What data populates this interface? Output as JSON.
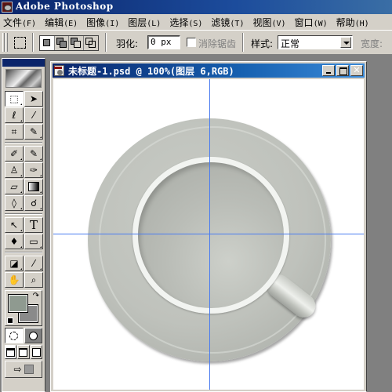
{
  "app": {
    "title": "Adobe Photoshop"
  },
  "menubar": {
    "items": [
      {
        "label": "文件",
        "accel": "(F)"
      },
      {
        "label": "编辑",
        "accel": "(E)"
      },
      {
        "label": "图像",
        "accel": "(I)"
      },
      {
        "label": "图层",
        "accel": "(L)"
      },
      {
        "label": "选择",
        "accel": "(S)"
      },
      {
        "label": "滤镜",
        "accel": "(T)"
      },
      {
        "label": "视图",
        "accel": "(V)"
      },
      {
        "label": "窗口",
        "accel": "(W)"
      },
      {
        "label": "帮助",
        "accel": "(H)"
      }
    ]
  },
  "options": {
    "feather_label": "羽化:",
    "feather_value": "0 px",
    "antialias_label": "消除锯齿",
    "antialias_checked": false,
    "style_label": "样式:",
    "style_value": "正常",
    "width_label": "宽度:",
    "selection_modes": [
      "new-selection",
      "add-to-selection",
      "subtract-from-selection",
      "intersect-selection"
    ],
    "active_mode": "new-selection"
  },
  "toolbox": {
    "tools": [
      {
        "name": "rectangular-marquee",
        "glyph": "⬚",
        "active": true
      },
      {
        "name": "move",
        "glyph": "➤"
      },
      {
        "name": "lasso",
        "glyph": "ℓ"
      },
      {
        "name": "magic-wand",
        "glyph": "⁄"
      },
      {
        "name": "crop",
        "glyph": "⌗"
      },
      {
        "name": "slice",
        "glyph": "✎"
      },
      {
        "name": "healing-brush",
        "glyph": "✐"
      },
      {
        "name": "brush",
        "glyph": "✎"
      },
      {
        "name": "clone-stamp",
        "glyph": "♙"
      },
      {
        "name": "history-brush",
        "glyph": "✑"
      },
      {
        "name": "eraser",
        "glyph": "▱"
      },
      {
        "name": "gradient",
        "glyph": "▦"
      },
      {
        "name": "blur",
        "glyph": "◊"
      },
      {
        "name": "dodge",
        "glyph": "☌"
      },
      {
        "name": "path-selection",
        "glyph": "↖"
      },
      {
        "name": "type",
        "glyph": "T"
      },
      {
        "name": "pen",
        "glyph": "♦"
      },
      {
        "name": "rectangle",
        "glyph": "▭"
      },
      {
        "name": "notes",
        "glyph": "◪"
      },
      {
        "name": "eyedropper",
        "glyph": "⁄"
      },
      {
        "name": "hand",
        "glyph": "✋"
      },
      {
        "name": "zoom",
        "glyph": "⌕"
      }
    ],
    "foreground_color": "#8f9a90",
    "background_color": "#8a8a8a",
    "swap_glyph": "↷",
    "jump_glyph": "⇨"
  },
  "document": {
    "title": "未标题-1.psd @ 100%(图层 6,RGB)",
    "close_glyph": "✕"
  },
  "colors": {
    "titlebar": "#0a246a",
    "chrome": "#d4d0c8",
    "guide": "#4a7cf0",
    "workspace": "#808080"
  }
}
